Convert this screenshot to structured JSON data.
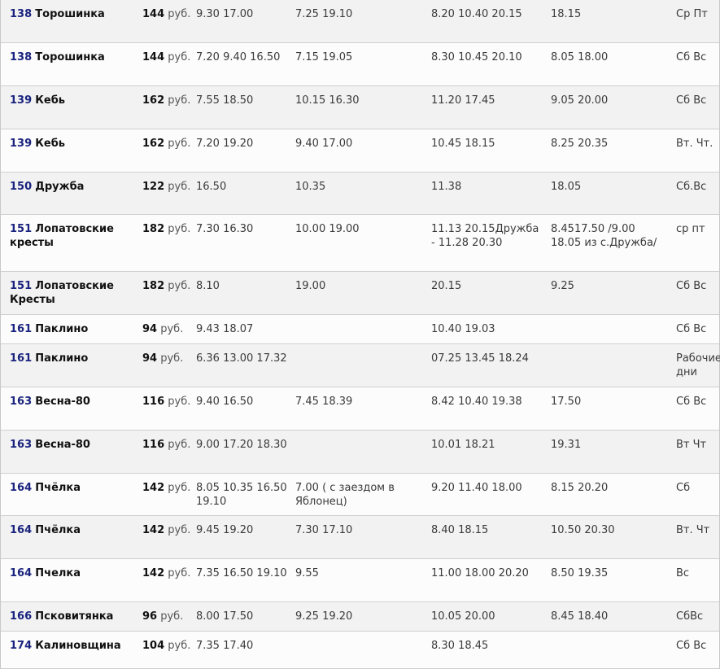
{
  "rows": [
    {
      "num": "138",
      "name": "Торошинка",
      "price": "144",
      "rub": "руб.",
      "t1": "9.30 17.00",
      "t2": "7.25 19.10",
      "t3": "8.20 10.40 20.15",
      "t4": "18.15",
      "days": "Ср Пт"
    },
    {
      "num": "138",
      "name": "Торошинка",
      "price": "144",
      "rub": "руб.",
      "t1": "7.20 9.40 16.50",
      "t2": "7.15 19.05",
      "t3": "8.30 10.45 20.10",
      "t4": "8.05 18.00",
      "days": "Сб Вс"
    },
    {
      "num": "139",
      "name": "Кебь",
      "price": "162",
      "rub": "руб.",
      "t1": "7.55 18.50",
      "t2": "10.15 16.30",
      "t3": "11.20 17.45",
      "t4": "9.05 20.00",
      "days": "Сб Вс"
    },
    {
      "num": "139",
      "name": "Кебь",
      "price": "162",
      "rub": "руб.",
      "t1": "7.20 19.20",
      "t2": "9.40 17.00",
      "t3": "10.45 18.15",
      "t4": "8.25 20.35",
      "days": "Вт. Чт."
    },
    {
      "num": "150",
      "name": "Дружба",
      "price": "122",
      "rub": "руб.",
      "t1": "16.50",
      "t2": "10.35",
      "t3": "11.38",
      "t4": "18.05",
      "days": "Сб.Вс"
    },
    {
      "num": "151",
      "name": "Лопатовские кресты",
      "price": "182",
      "rub": "руб.",
      "t1": "7.30 16.30",
      "t2": "10.00 19.00",
      "t3": "11.13 20.15Дружба - 11.28 20.30",
      "t4": "8.4517.50 /9.00 18.05 из с.Дружба/",
      "days": "ср пт"
    },
    {
      "num": "151",
      "name": "Лопатовские Кресты",
      "price": "182",
      "rub": "руб.",
      "t1": "8.10",
      "t2": "19.00",
      "t3": "20.15",
      "t4": "9.25",
      "days": "Сб Вс"
    },
    {
      "num": "161",
      "name": "Паклино",
      "price": "94",
      "rub": "руб.",
      "t1": "9.43 18.07",
      "t2": "",
      "t3": "10.40 19.03",
      "t4": "",
      "days": "Сб Вс"
    },
    {
      "num": "161",
      "name": "Паклино",
      "price": "94",
      "rub": "руб.",
      "t1": "6.36 13.00 17.32",
      "t2": "",
      "t3": "07.25 13.45 18.24",
      "t4": "",
      "days": "Рабочие дни"
    },
    {
      "num": "163",
      "name": "Весна-80",
      "price": "116",
      "rub": "руб.",
      "t1": "9.40 16.50",
      "t2": "7.45 18.39",
      "t3": "8.42 10.40 19.38",
      "t4": "17.50",
      "days": "Сб Вс"
    },
    {
      "num": "163",
      "name": "Весна-80",
      "price": "116",
      "rub": "руб.",
      "t1": "9.00 17.20 18.30",
      "t2": "",
      "t3": "10.01 18.21",
      "t4": "19.31",
      "days": "Вт Чт"
    },
    {
      "num": "164",
      "name": "Пчёлка",
      "price": "142",
      "rub": "руб.",
      "t1": "8.05 10.35 16.50 19.10",
      "t2": "7.00 ( с заездом в Яблонец)",
      "t3": "9.20 11.40 18.00",
      "t4": "8.15 20.20",
      "days": "Сб"
    },
    {
      "num": "164",
      "name": "Пчёлка",
      "price": "142",
      "rub": "руб.",
      "t1": "9.45 19.20",
      "t2": "7.30 17.10",
      "t3": "8.40 18.15",
      "t4": "10.50 20.30",
      "days": "Вт. Чт"
    },
    {
      "num": "164",
      "name": "Пчелка",
      "price": "142",
      "rub": "руб.",
      "t1": "7.35 16.50 19.10",
      "t2": "9.55",
      "t3": "11.00 18.00 20.20",
      "t4": "8.50 19.35",
      "days": "Вс"
    },
    {
      "num": "166",
      "name": "Псковитянка",
      "price": "96",
      "rub": "руб.",
      "t1": "8.00 17.50",
      "t2": "9.25 19.20",
      "t3": "10.05 20.00",
      "t4": "8.45 18.40",
      "days": "СбВс"
    },
    {
      "num": "174",
      "name": "Калиновщина",
      "price": "104",
      "rub": "руб.",
      "t1": "7.35 17.40",
      "t2": "",
      "t3": "8.30 18.45",
      "t4": "",
      "days": "Сб Вс"
    }
  ]
}
